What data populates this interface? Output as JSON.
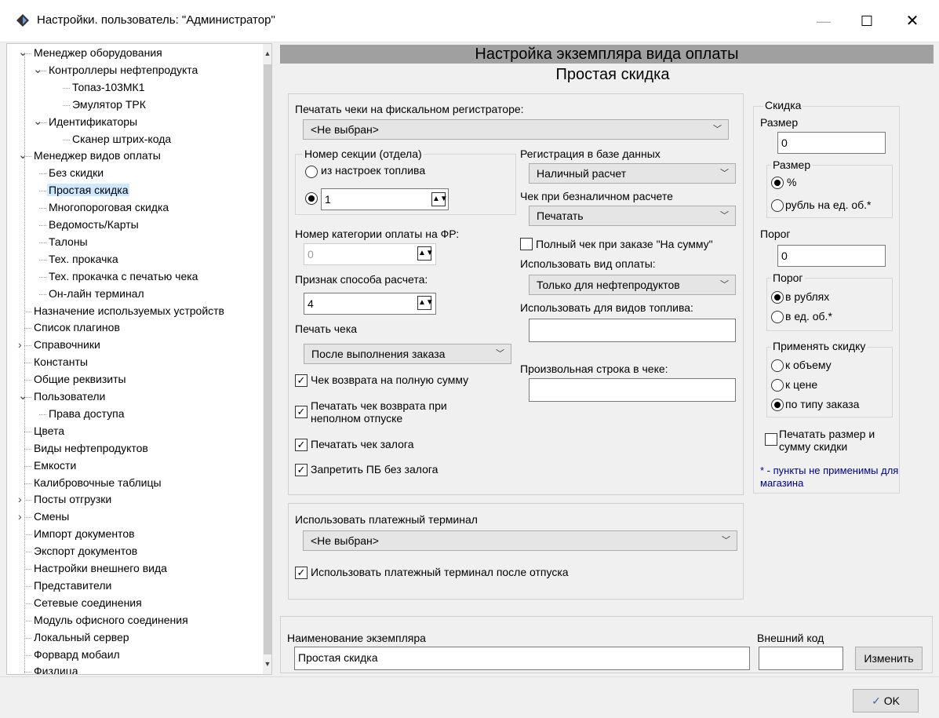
{
  "window": {
    "title": "Настройки. пользователь: \"Администратор\""
  },
  "tree": {
    "items": [
      {
        "label": "Менеджер оборудования"
      },
      {
        "label": "Контроллеры нефтепродукта"
      },
      {
        "label": "Топаз-103МК1"
      },
      {
        "label": "Эмулятор ТРК"
      },
      {
        "label": "Идентификаторы"
      },
      {
        "label": "Сканер штрих-кода"
      },
      {
        "label": "Менеджер видов оплаты"
      },
      {
        "label": "Без скидки"
      },
      {
        "label": "Простая скидка"
      },
      {
        "label": "Многопороговая скидка"
      },
      {
        "label": "Ведомость/Карты"
      },
      {
        "label": "Талоны"
      },
      {
        "label": "Тех. прокачка"
      },
      {
        "label": "Тех. прокачка с печатью чека"
      },
      {
        "label": "Он-лайн терминал"
      },
      {
        "label": "Назначение используемых устройств"
      },
      {
        "label": "Список плагинов"
      },
      {
        "label": "Справочники"
      },
      {
        "label": "Константы"
      },
      {
        "label": "Общие реквизиты"
      },
      {
        "label": "Пользователи"
      },
      {
        "label": "Права доступа"
      },
      {
        "label": "Цвета"
      },
      {
        "label": "Виды нефтепродуктов"
      },
      {
        "label": "Емкости"
      },
      {
        "label": "Калибровочные таблицы"
      },
      {
        "label": "Посты отгрузки"
      },
      {
        "label": "Смены"
      },
      {
        "label": "Импорт документов"
      },
      {
        "label": "Экспорт документов"
      },
      {
        "label": "Настройки внешнего вида"
      },
      {
        "label": "Представители"
      },
      {
        "label": "Сетевые соединения"
      },
      {
        "label": "Модуль офисного соединения"
      },
      {
        "label": "Локальный сервер"
      },
      {
        "label": "Форвард мобаил"
      },
      {
        "label": "Физлица"
      }
    ]
  },
  "header": {
    "title": "Настройка экземпляра вида оплаты",
    "subtitle": "Простая скидка"
  },
  "main": {
    "fiscal_label": "Печатать чеки на фискальном регистраторе:",
    "fiscal_value": "<Не выбран>",
    "section_group": "Номер секции (отдела)",
    "section_from_fuel": "из настроек топлива",
    "section_value": "1",
    "pay_category_label": "Номер категории оплаты на ФР:",
    "pay_category_value": "0",
    "calc_method_label": "Признак способа расчета:",
    "calc_method_value": "4",
    "print_check_label": "Печать чека",
    "print_check_value": "После выполнения заказа",
    "chk_return_full": "Чек возврата на полную сумму",
    "chk_return_partial": "Печатать чек возврата при неполном отпуске",
    "chk_deposit": "Печатать чек залога",
    "chk_forbid_pb": "Запретить ПБ без залога",
    "db_reg_label": "Регистрация в базе данных",
    "db_reg_value": "Наличный расчет",
    "cashless_label": "Чек при безналичном расчете",
    "cashless_value": "Печатать",
    "full_check_label": "Полный чек при заказе \"На сумму\"",
    "use_payment_label": "Использовать вид оплаты:",
    "use_payment_value": "Только для нефтепродуктов",
    "fuel_types_label": "Использовать для видов топлива:",
    "fuel_types_value": "",
    "custom_line_label": "Произвольная строка в чеке:",
    "custom_line_value": ""
  },
  "terminal": {
    "label": "Использовать платежный терминал",
    "value": "<Не выбран>",
    "after_release": "Использовать платежный терминал после отпуска"
  },
  "discount": {
    "group": "Скидка",
    "size_label": "Размер",
    "size_value": "0",
    "size_group": "Размер",
    "size_percent": "%",
    "size_rub": "рубль на ед. об.*",
    "threshold_label": "Порог",
    "threshold_value": "0",
    "threshold_group": "Порог",
    "threshold_rub": "в рублях",
    "threshold_units": "в ед. об.*",
    "apply_group": "Применять скидку",
    "apply_volume": "к объему",
    "apply_price": "к цене",
    "apply_order": "по типу заказа",
    "print_size": "Печатать размер и сумму скидки",
    "note": "* - пункты не применимы для магазина"
  },
  "footer": {
    "name_label": "Наименование экземпляра",
    "name_value": "Простая скидка",
    "ext_code_label": "Внешний код",
    "ext_code_value": "",
    "change_button": "Изменить",
    "ok_button": "OK"
  }
}
